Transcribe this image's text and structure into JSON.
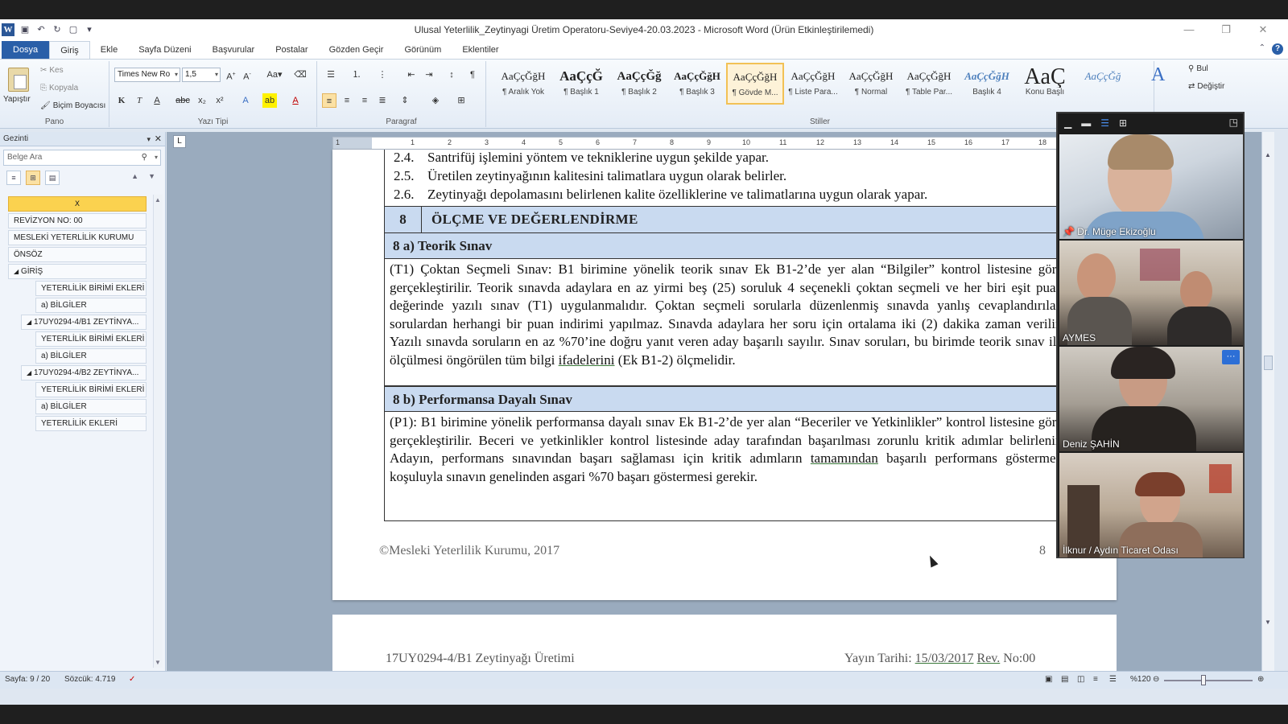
{
  "window": {
    "title": "Ulusal Yeterlilik_Zeytinyagi Üretim Operatoru-Seviye4-20.03.2023  -  Microsoft Word (Ürün Etkinleştirilemedi)",
    "app_icon": "W"
  },
  "tabs": [
    "Dosya",
    "Giriş",
    "Ekle",
    "Sayfa Düzeni",
    "Başvurular",
    "Postalar",
    "Gözden Geçir",
    "Görünüm",
    "Eklentiler"
  ],
  "ribbon": {
    "clipboard": {
      "paste": "Yapıştır",
      "cut": "Kes",
      "copy": "Kopyala",
      "format_painter": "Biçim Boyacısı",
      "label": "Pano"
    },
    "font": {
      "name": "Times New Ro",
      "size": "1,5",
      "label": "Yazı Tipi",
      "bold": "K",
      "italic": "T",
      "underline": "A"
    },
    "paragraph": {
      "label": "Paragraf"
    },
    "styles": {
      "label": "Stiller",
      "items": [
        {
          "sample": "AaÇçĞğH",
          "name": "¶ Aralık Yok"
        },
        {
          "sample": "AaÇçĞ",
          "name": "¶ Başlık 1"
        },
        {
          "sample": "AaÇçĞğ",
          "name": "¶ Başlık 2"
        },
        {
          "sample": "AaÇçĞğH",
          "name": "¶ Başlık 3"
        },
        {
          "sample": "AaÇçĞğH",
          "name": "¶ Gövde M..."
        },
        {
          "sample": "AaÇçĞğH",
          "name": "¶ Liste Para..."
        },
        {
          "sample": "AaÇçĞğH",
          "name": "¶ Normal"
        },
        {
          "sample": "AaÇçĞğH",
          "name": "¶ Table Par..."
        },
        {
          "sample": "AaÇçĞğH",
          "name": "Başlık 4"
        },
        {
          "sample": "AaÇ",
          "name": "Konu Başlı"
        },
        {
          "sample": "AaÇçĞğ",
          "name": ""
        }
      ]
    },
    "editing": {
      "find": "Bul",
      "replace": "Değiştir"
    }
  },
  "nav": {
    "title": "Gezinti",
    "search_placeholder": "Belge Ara",
    "items": [
      "",
      "REVİZYON NO: 00",
      "MESLEKİ YETERLİLİK KURUMU",
      "ÖNSÖZ",
      "GİRİŞ",
      "YETERLİLİK BİRİMİ EKLERİ",
      "a) BİLGİLER",
      "17UY0294-4/B1 ZEYTİNYA...",
      "YETERLİLİK BİRİMİ EKLERİ",
      "a) BİLGİLER",
      "17UY0294-4/B2 ZEYTİNYA...",
      "YETERLİLİK BİRİMİ EKLERİ",
      "a) BİLGİLER",
      "YETERLİLİK EKLERİ"
    ]
  },
  "ruler": {
    "ticks": [
      "1",
      "1",
      "2",
      "3",
      "4",
      "5",
      "6",
      "7",
      "8",
      "9",
      "10",
      "11",
      "12",
      "13",
      "14",
      "15",
      "16",
      "17",
      "18"
    ]
  },
  "document": {
    "items": [
      {
        "num": "2.4.",
        "text": "Santrifüj işlemini yöntem ve tekniklerine uygun şekilde yapar."
      },
      {
        "num": "2.5.",
        "text": "Üretilen zeytinyağının kalitesini talimatlara uygun olarak belirler."
      },
      {
        "num": "2.6.",
        "text": "Zeytinyağı depolamasını belirlenen kalite özelliklerine ve talimatlarına uygun olarak yapar."
      }
    ],
    "section_num": "8",
    "section_title": "ÖLÇME VE DEĞERLENDİRME",
    "sub_a": "8 a) Teorik Sınav",
    "para_a": "(T1) Çoktan Seçmeli Sınav: B1 birimine yönelik teorik sınav Ek B1-2’de yer alan “Bilgiler” kontrol listesine göre gerçekleştirilir. Teorik sınavda adaylara en az yirmi beş (25) soruluk 4 seçenekli çoktan seçmeli ve her biri eşit puan değerinde yazılı sınav (T1) uygulanmalıdır. Çoktan seçmeli sorularla düzenlenmiş sınavda yanlış cevaplandırılan sorulardan herhangi bir puan indirimi yapılmaz. Sınavda adaylara her soru için ortalama iki (2) dakika zaman verilir. Yazılı sınavda soruların en az %70’ine doğru yanıt veren aday başarılı sayılır. Sınav soruları, bu birimde teorik sınav ile ölçülmesi öngörülen tüm bilgi",
    "para_a_ul": "ifadelerini",
    "para_a_end": " (Ek B1-2) ölçmelidir.",
    "sub_b": "8 b) Performansa Dayalı Sınav",
    "para_b": "(P1): B1 birimine yönelik performansa dayalı sınav Ek B1-2’de yer alan “Beceriler ve Yetkinlikler” kontrol listesine göre gerçekleştirilir. Beceri ve yetkinlikler kontrol listesinde aday tarafından başarılması zorunlu kritik adımlar belirlenir. Adayın, performans sınavından başarı sağlaması için kritik adımların",
    "para_b_ul": "tamamından",
    "para_b_end": " başarılı performans göstermek koşuluyla sınavın genelinden asgari %70 başarı göstermesi gerekir.",
    "footer_left": "©Mesleki Yeterlilik Kurumu, 2017",
    "footer_page": "8",
    "page2_header_left": "17UY0294-4/B1 Zeytinyağı Üretimi",
    "page2_header_right_prefix": "Yayın Tarihi: ",
    "page2_header_date": "15/03/2017",
    "page2_header_rev": "Rev.",
    "page2_header_revno": " No:00"
  },
  "video": {
    "participants": [
      "Dr. Müge Ekizoğlu",
      "AYMES",
      "Deniz ŞAHİN",
      "İlknur / Aydın Ticaret Odası"
    ],
    "more_label": "···"
  },
  "status": {
    "page": "Sayfa: 9 / 20",
    "words": "Sözcük: 4.719",
    "zoom": "%120"
  }
}
